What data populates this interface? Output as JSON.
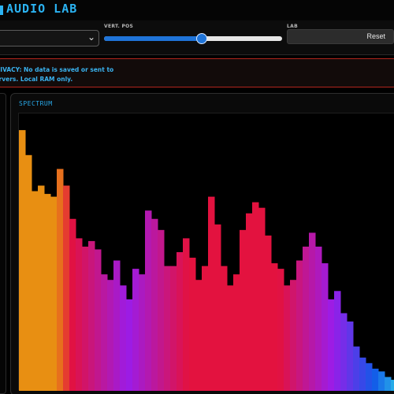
{
  "header": {
    "title": "AUDIO LAB"
  },
  "controls": {
    "source_select": {
      "value": ""
    },
    "vert_pos": {
      "label": "VERT. POS",
      "value": 0.55
    },
    "lab": {
      "label": "LAB",
      "reset_label": "Reset"
    }
  },
  "privacy_notice": {
    "line1": "PRIVACY: No data is saved or sent to",
    "line2": "servers. Local RAM only."
  },
  "spectrum": {
    "title": "SPECTRUM",
    "colors": {
      "low": "#e88f12",
      "mid": "#e3123f",
      "violet": "#9b1ce8",
      "high": "#1259e8",
      "end": "#2ec4e8"
    }
  },
  "chart_data": {
    "type": "bar",
    "x": [
      0,
      8,
      16,
      24,
      32,
      40,
      48,
      56,
      64,
      72,
      80,
      88,
      96,
      104,
      112,
      120,
      128,
      136,
      144,
      152,
      160,
      168,
      176,
      184,
      192,
      200,
      208,
      216,
      224,
      232,
      240,
      248,
      256,
      264,
      272,
      280,
      288,
      296,
      304,
      312,
      320,
      328,
      336,
      344,
      352,
      360,
      368,
      376,
      384,
      392,
      400,
      408,
      416,
      424,
      432,
      440,
      448,
      456,
      464,
      472
    ],
    "values": [
      0.94,
      0.85,
      0.72,
      0.74,
      0.71,
      0.7,
      0.8,
      0.74,
      0.62,
      0.55,
      0.52,
      0.54,
      0.51,
      0.42,
      0.4,
      0.47,
      0.38,
      0.33,
      0.44,
      0.42,
      0.65,
      0.62,
      0.58,
      0.45,
      0.45,
      0.5,
      0.55,
      0.48,
      0.4,
      0.45,
      0.7,
      0.6,
      0.45,
      0.38,
      0.42,
      0.58,
      0.64,
      0.68,
      0.66,
      0.56,
      0.46,
      0.44,
      0.38,
      0.4,
      0.47,
      0.52,
      0.57,
      0.52,
      0.46,
      0.33,
      0.36,
      0.28,
      0.25,
      0.16,
      0.12,
      0.1,
      0.08,
      0.07,
      0.05,
      0.04
    ],
    "ylim": [
      0,
      1
    ]
  }
}
